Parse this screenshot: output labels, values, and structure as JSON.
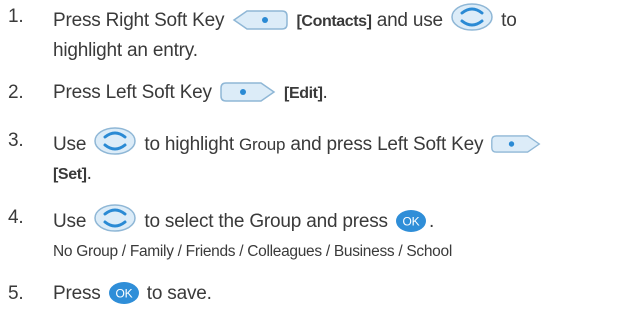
{
  "steps": [
    {
      "num": "1.",
      "t1": "Press Right Soft Key",
      "k1": "[Contacts]",
      "t2": "and use",
      "t3": "to",
      "t4": "highlight an entry.",
      "icons": [
        "right-soft-key-icon",
        "navigation-key-icon"
      ]
    },
    {
      "num": "2.",
      "t1": "Press Left Soft Key",
      "k1": "[Edit]",
      "t2": ".",
      "icons": [
        "left-soft-key-icon"
      ]
    },
    {
      "num": "3.",
      "t1": "Use",
      "t2": "to highlight",
      "ui": "Group",
      "t3": "and press Left Soft Key",
      "k1": "[Set]",
      "t4": ".",
      "icons": [
        "navigation-key-icon",
        "left-soft-key-icon"
      ]
    },
    {
      "num": "4.",
      "t1": "Use",
      "t2": "to select the Group and press",
      "t3": ".",
      "sub": "No Group / Family / Friends / Colleagues / Business / School",
      "icons": [
        "navigation-key-icon",
        "ok-key-icon"
      ]
    },
    {
      "num": "5.",
      "t1": "Press",
      "t2": "to save.",
      "icons": [
        "ok-key-icon"
      ]
    }
  ],
  "ok_label": "OK",
  "colors": {
    "text": "#3a3a3a",
    "key_fill": "#dcecf8",
    "key_stroke": "#8fb7d6",
    "key_dot": "#2a8ad4",
    "ok_fill": "#2f8ed8"
  }
}
